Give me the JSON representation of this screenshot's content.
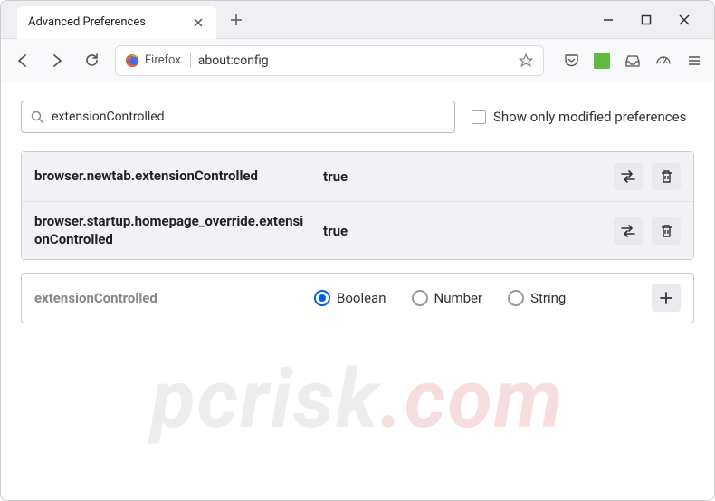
{
  "window": {
    "tab_title": "Advanced Preferences"
  },
  "urlbar": {
    "identity": "Firefox",
    "url": "about:config"
  },
  "search": {
    "value": "extensionControlled",
    "checkbox_label": "Show only modified preferences"
  },
  "prefs": [
    {
      "name": "browser.newtab.extensionControlled",
      "value": "true"
    },
    {
      "name": "browser.startup.homepage_override.extensionControlled",
      "value": "true"
    }
  ],
  "new_pref": {
    "name": "extensionControlled",
    "types": [
      "Boolean",
      "Number",
      "String"
    ],
    "selected": 0
  },
  "watermark": {
    "text": "pcrisk",
    "tld": ".com"
  }
}
